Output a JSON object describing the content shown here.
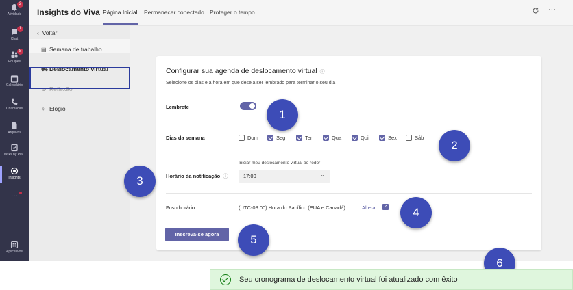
{
  "rail": {
    "items": [
      {
        "label": "Atividade",
        "icon": "bell-icon",
        "badge": "2"
      },
      {
        "label": "Chat",
        "icon": "chat-icon",
        "badge": "1"
      },
      {
        "label": "Equipes",
        "icon": "teams-icon",
        "badge": "8"
      },
      {
        "label": "Calendário",
        "icon": "calendar-icon"
      },
      {
        "label": "Chamadas",
        "icon": "phone-icon"
      },
      {
        "label": "Arquivos",
        "icon": "file-icon"
      },
      {
        "label": "Tasks by Pla...",
        "icon": "tasks-icon"
      },
      {
        "label": "Insights",
        "icon": "insights-icon"
      },
      {
        "label": "Aplicativos",
        "icon": "apps-icon"
      }
    ],
    "more": "···"
  },
  "topbar": {
    "title": "Insights do Viva",
    "tabs": [
      "Página Inicial",
      "Permanecer conectado",
      "Proteger o tempo"
    ],
    "refresh_icon": "refresh-icon",
    "more_icon": "more-icon",
    "more_label": "···"
  },
  "subnav": {
    "back": "Voltar",
    "items": [
      {
        "label": "Semana de trabalho",
        "icon": "calendar-week-icon"
      },
      {
        "label": "Deslocamento virtual",
        "icon": "car-icon"
      },
      {
        "label": "Reflexão",
        "icon": "emoji-icon"
      },
      {
        "label": "Elogio",
        "icon": "lightbulb-icon"
      }
    ]
  },
  "card": {
    "title": "Configurar sua agenda de deslocamento virtual",
    "info_icon": "ⓘ",
    "subtitle": "Selecione os dias e a hora em que deseja ser lembrado para terminar o seu dia",
    "reminder_label": "Lembrete",
    "days_label": "Dias da semana",
    "days": [
      {
        "label": "Dom",
        "checked": false
      },
      {
        "label": "Seg",
        "checked": true
      },
      {
        "label": "Ter",
        "checked": true
      },
      {
        "label": "Qua",
        "checked": true
      },
      {
        "label": "Qui",
        "checked": true
      },
      {
        "label": "Sex",
        "checked": true
      },
      {
        "label": "Sáb",
        "checked": false
      }
    ],
    "notification_label": "Horário da notificação",
    "notification_hint": "Iniciar meu deslocamento virtual ao redor",
    "notification_time": "17:00",
    "timezone_label": "Fuso horário",
    "timezone_value": "(UTC-08:00) Hora do Pacífico (EUA e Canadá)",
    "timezone_change": "Alterar",
    "subscribe": "Inscreva-se agora"
  },
  "callouts": [
    "1",
    "2",
    "3",
    "4",
    "5",
    "6"
  ],
  "toast": {
    "message": "Seu cronograma de deslocamento virtual foi atualizado com êxito"
  },
  "colors": {
    "accent": "#6264a7",
    "rail": "#33344a",
    "callout": "#3d4cb7",
    "toast_bg": "#dff6dd",
    "success": "#107c10"
  }
}
